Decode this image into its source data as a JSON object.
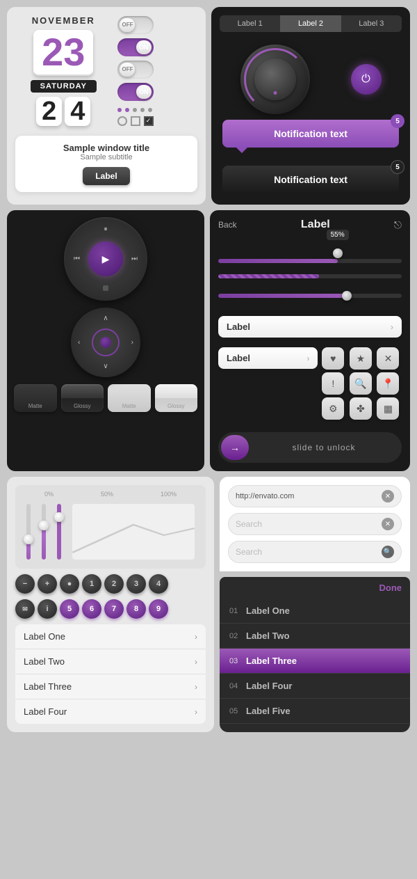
{
  "row1": {
    "left": {
      "month": "NOVEMBER",
      "day_big": "23",
      "weekday": "SATURDAY",
      "small_days": [
        "2",
        "4"
      ],
      "toggles": [
        {
          "label": "OFF",
          "state": "off"
        },
        {
          "label": "ON",
          "state": "on"
        },
        {
          "label": "OFF",
          "state": "off"
        },
        {
          "label": "ON",
          "state": "on"
        }
      ],
      "window": {
        "title": "Sample window title",
        "subtitle": "Sample subtitle",
        "btn_label": "Label"
      }
    },
    "right": {
      "tabs": [
        "Label 1",
        "Label 2",
        "Label 3"
      ],
      "active_tab": 1,
      "notification_text": "Notification text",
      "notification_text2": "Notification text",
      "badge1": "5",
      "badge2": "5"
    }
  },
  "row2": {
    "left": {
      "btn_labels": [
        "Matte",
        "Glossy",
        "Matte",
        "Glossy"
      ]
    },
    "right": {
      "back_label": "Back",
      "title": "Label",
      "slider_value": "55%",
      "slider1_pct": 65,
      "slider2_pct": 55,
      "slider3_pct": 70,
      "list_items": [
        {
          "label": "Label",
          "has_arrow": true
        },
        {
          "label": "Label",
          "has_arrow": true
        }
      ],
      "slide_text": "slide to unlock"
    }
  },
  "row3": {
    "left": {
      "eq_labels": [
        "0%",
        "50%",
        "100%"
      ],
      "eq_heights": [
        30,
        55,
        70
      ],
      "eq_thumb_positions": [
        70,
        45,
        30
      ],
      "circle_btns_row1": [
        "−",
        "+",
        "●",
        "1",
        "2",
        "3",
        "4"
      ],
      "circle_btns_row2": [
        "✉",
        "ℹ",
        "5",
        "6",
        "7",
        "8",
        "9"
      ],
      "list_items": [
        {
          "label": "Label One"
        },
        {
          "label": "Label Two"
        },
        {
          "label": "Label Three"
        },
        {
          "label": "Label Four"
        }
      ]
    },
    "right": {
      "url_value": "http://envato.com",
      "search_placeholder1": "Search",
      "search_placeholder2": "Search",
      "done_label": "Done",
      "picker_items": [
        {
          "num": "01",
          "label": "Label One",
          "selected": false
        },
        {
          "num": "02",
          "label": "Label Two",
          "selected": false
        },
        {
          "num": "03",
          "label": "Label Three",
          "selected": true
        },
        {
          "num": "04",
          "label": "Label Four",
          "selected": false
        },
        {
          "num": "05",
          "label": "Label Five",
          "selected": false
        }
      ]
    }
  },
  "colors": {
    "purple": "#9b59b6",
    "dark": "#1a1a1a",
    "light_bg": "#e8e8e8"
  }
}
